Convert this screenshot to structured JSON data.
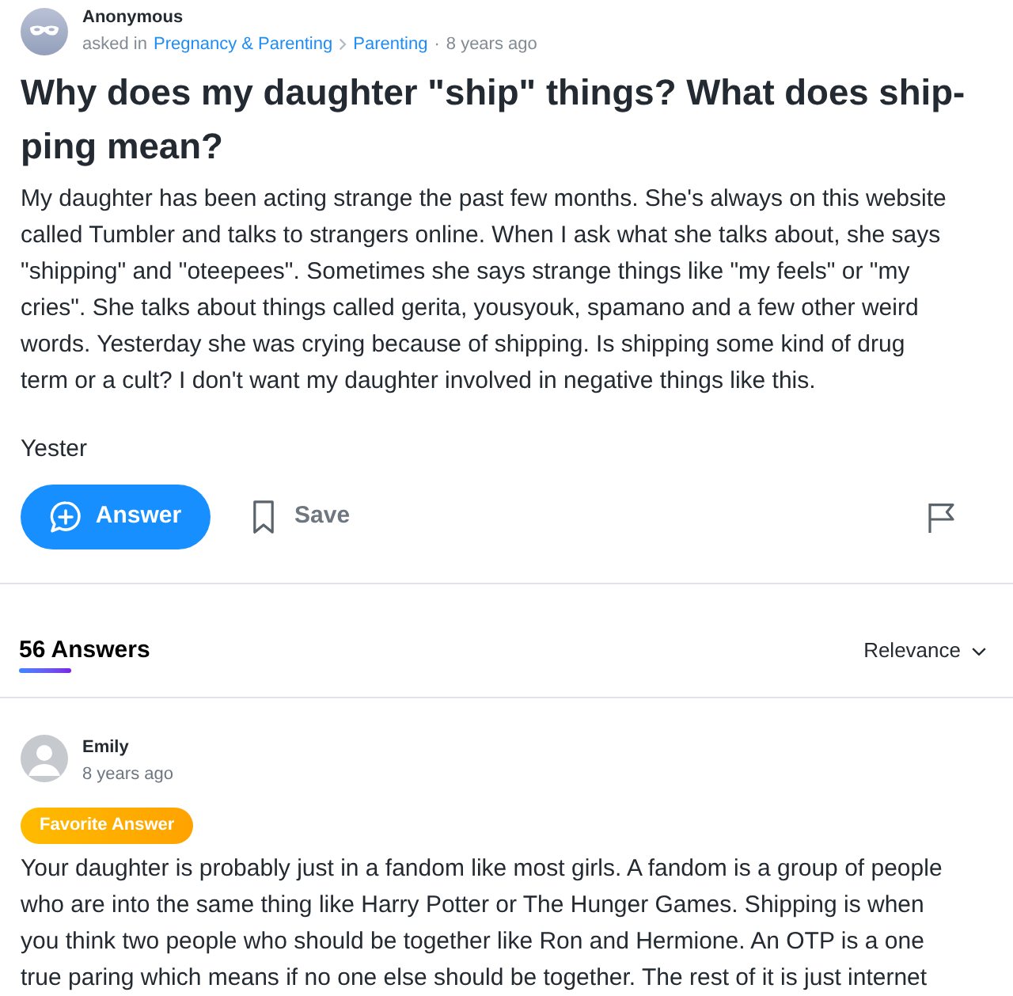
{
  "question": {
    "author": "Anonymous",
    "asked_in": "asked in",
    "breadcrumbs": [
      "Pregnancy & Parenting",
      "Parenting"
    ],
    "separator": "·",
    "time": "8 years ago",
    "title": "Why does my daughter \"ship\" things? What does ship-ping mean?",
    "paragraphs": [
      "My daughter has been acting strange the past few months. She's always on this website called Tumbler and talks to strangers online. When I ask what she talks about, she says \"shipping\" and \"oteepees\". Sometimes she says strange things like \"my feels\" or \"my cries\". She talks about things called gerita, yousyouk, spamano and a few other weird words. Yesterday she was crying because of shipping. Is shipping some kind of drug term or a cult? I don't want my daughter involved in negative things like this.",
      "Yester"
    ]
  },
  "actions": {
    "answer_button": "Answer",
    "save_button": "Save"
  },
  "answers_header": {
    "tab": {
      "label": "56 Answers",
      "selected": true
    },
    "sort": "Relevance"
  },
  "answers": [
    {
      "author": "Emily",
      "time": "8 years ago",
      "badge": "Favorite Answer",
      "text": "Your daughter is probably just in a fandom like most girls. A fandom is a group of people who are into the same thing like Harry Potter or The Hunger Games. Shipping is when you think two people who should be together like Ron and Hermione. An OTP is a one true paring which means if no one else should be together. The rest of it is just internet"
    }
  ]
}
